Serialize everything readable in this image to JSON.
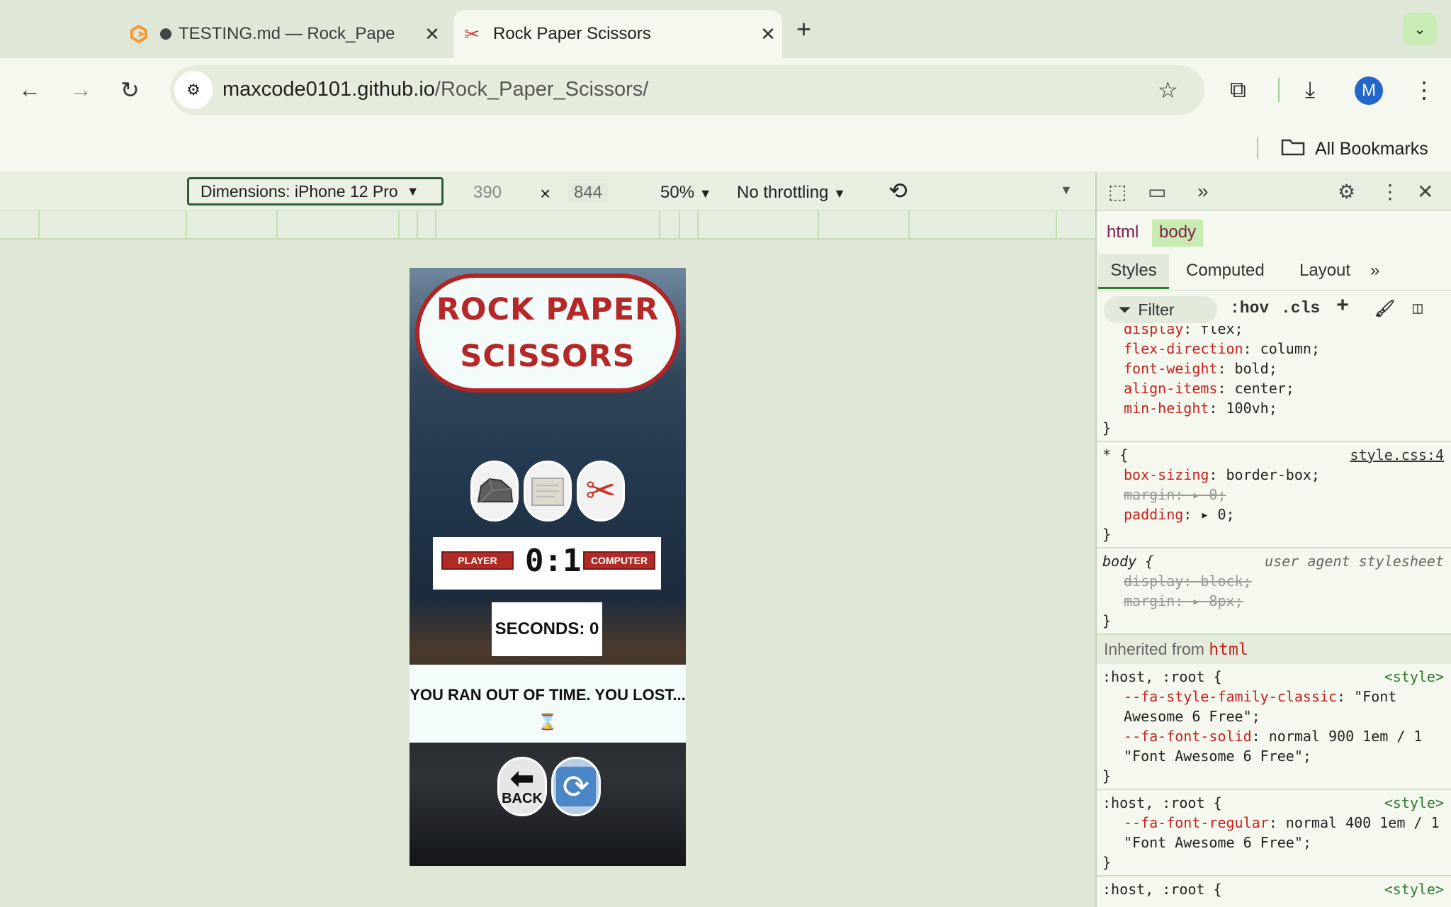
{
  "tabs": [
    {
      "title": "TESTING.md — Rock_Pape",
      "active": false,
      "unsaved": true,
      "icon": "gitpod-icon"
    },
    {
      "title": "Rock Paper Scissors",
      "active": true,
      "icon": "scissors-icon"
    }
  ],
  "address_bar": {
    "host": "maxcode0101.github.io",
    "path": "/Rock_Paper_Scissors/"
  },
  "profile": {
    "initial": "M"
  },
  "bookmarks": {
    "all_label": "All Bookmarks"
  },
  "device_toolbar": {
    "dimensions": "Dimensions: iPhone 12 Pro",
    "width": "390",
    "times": "×",
    "height": "844",
    "zoom": "50%",
    "throttling": "No throttling"
  },
  "game": {
    "title_line1": "ROCK PAPER",
    "title_line2": "SCISSORS",
    "choices": [
      "rock",
      "paper",
      "scissors"
    ],
    "player_label": "PLAYER",
    "computer_label": "COMPUTER",
    "score": "0:1",
    "seconds": "SECONDS: 0",
    "message": "YOU RAN OUT OF TIME. YOU LOST...",
    "message_icon": "⌛",
    "back_label": "BACK"
  },
  "devtools": {
    "breadcrumbs": [
      "html",
      "body"
    ],
    "panel_tabs": [
      "Styles",
      "Computed",
      "Layout"
    ],
    "filter_placeholder": "Filter",
    "hov": ":hov",
    "cls": ".cls",
    "rules": {
      "body_partial": [
        {
          "name": "display",
          "value": "flex;"
        },
        {
          "name": "flex-direction",
          "value": "column;"
        },
        {
          "name": "font-weight",
          "value": "bold;"
        },
        {
          "name": "align-items",
          "value": "center;"
        },
        {
          "name": "min-height",
          "value": "100vh;"
        }
      ],
      "star": {
        "selector": "* {",
        "source": "style.css:4",
        "props": [
          {
            "name": "box-sizing",
            "value": "border-box;",
            "struck": false
          },
          {
            "name": "margin",
            "value": "▸ 0;",
            "struck": true
          },
          {
            "name": "padding",
            "value": "▸ 0;",
            "struck": false
          }
        ]
      },
      "ua": {
        "selector": "body {",
        "source": "user agent stylesheet",
        "props": [
          {
            "name": "display",
            "value": "block;",
            "struck": true
          },
          {
            "name": "margin",
            "value": "▸ 8px;",
            "struck": true
          }
        ]
      },
      "inherited_label": "Inherited from",
      "inherited_from": "html",
      "host1": {
        "selector": ":host, :root {",
        "source": "<style>",
        "props": [
          {
            "name": "--fa-style-family-classic",
            "value": "\"Font Awesome 6 Free\";"
          },
          {
            "name": "--fa-font-solid",
            "value": "normal 900 1em / 1 \"Font Awesome 6 Free\";"
          }
        ]
      },
      "host2": {
        "selector": ":host, :root {",
        "source": "<style>",
        "props": [
          {
            "name": "--fa-font-regular",
            "value": "normal 400 1em / 1 \"Font Awesome 6 Free\";"
          }
        ]
      },
      "host3": {
        "selector": ":host, :root {",
        "source": "<style>"
      },
      "close_brace": "}"
    }
  }
}
